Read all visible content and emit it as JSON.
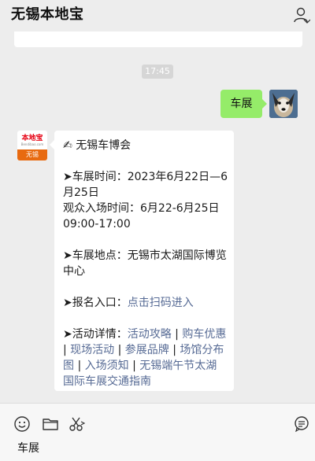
{
  "header": {
    "title": "无锡本地宝",
    "user_icon": "user-icon"
  },
  "time_stamp": "17:45",
  "outgoing": {
    "text": "车展"
  },
  "bot": {
    "avatar": {
      "logo_text": "本地宝",
      "logo_url": "Bendibao.com",
      "logo_city": "无锡"
    },
    "headline_icon": "✍",
    "headline": "无锡车博会",
    "date_label": "➤车展时间：2023年6月22日—6月25日",
    "entry_time_label": "观众入场时间：6月22-6月25日09:00-17:00",
    "venue_label": "➤车展地点：无锡市太湖国际博览中心",
    "signup_prefix": "➤报名入口：",
    "signup_link": "点击扫码进入",
    "details_prefix": "➤活动详情：",
    "details_links": [
      "活动攻略",
      "购车优惠",
      "现场活动",
      "参展品牌",
      "场馆分布图",
      "入场须知",
      "无锡端午节太湖国际车展交通指南"
    ],
    "separator": " | "
  },
  "input_bar": {
    "text": "车展",
    "icons": [
      "emoji-icon",
      "folder-icon",
      "scissors-icon",
      "chat-history-icon"
    ]
  },
  "colors": {
    "background": "#ededed",
    "outgoing_bubble": "#95ec69",
    "link": "#576b95",
    "brand_red": "#e60012"
  }
}
